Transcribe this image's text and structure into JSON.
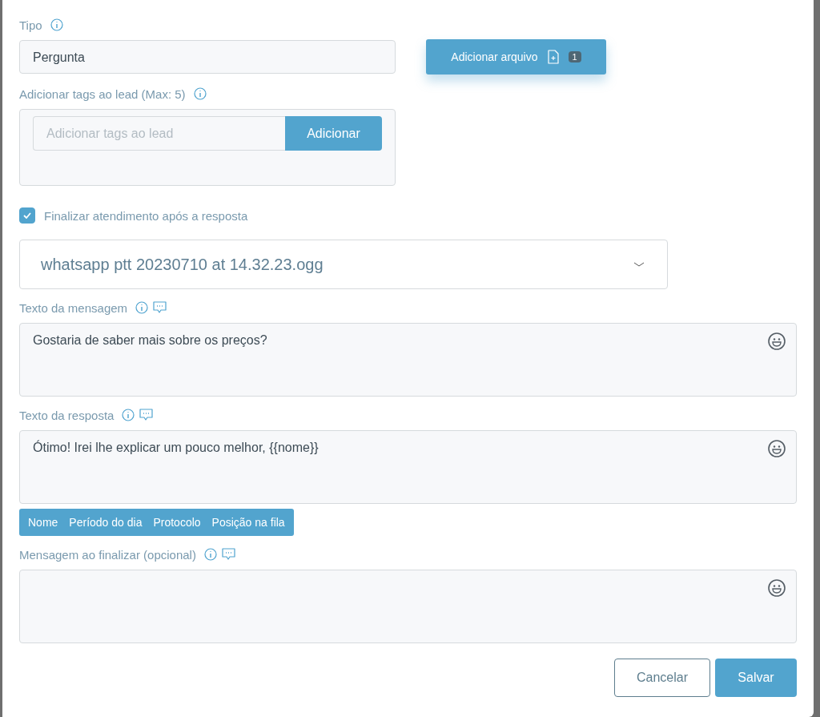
{
  "tipo": {
    "label": "Tipo",
    "value": "Pergunta"
  },
  "attach": {
    "label": "Adicionar arquivo",
    "count": "1"
  },
  "tags": {
    "label": "Adicionar tags ao lead (Max: 5)",
    "placeholder": "Adicionar tags ao lead",
    "button": "Adicionar"
  },
  "finalize": {
    "label": "Finalizar atendimento após a resposta",
    "checked": true
  },
  "audio": {
    "value": "whatsapp ptt 20230710 at 14.32.23.ogg"
  },
  "messages": [
    {
      "label": "Texto da mensagem",
      "value": "Gostaria de saber mais sobre os preços?"
    },
    {
      "label": "Texto da resposta",
      "value": "Ótimo! Irei lhe explicar um pouco melhor, {{nome}}",
      "variables": [
        "Nome",
        "Período do dia",
        "Protocolo",
        "Posição na fila"
      ]
    },
    {
      "label": "Mensagem ao finalizar (opcional)"
    }
  ],
  "buttons": [
    {
      "label": "Cancelar",
      "kind": "secondary"
    },
    {
      "label": "Salvar",
      "kind": "primary"
    }
  ]
}
